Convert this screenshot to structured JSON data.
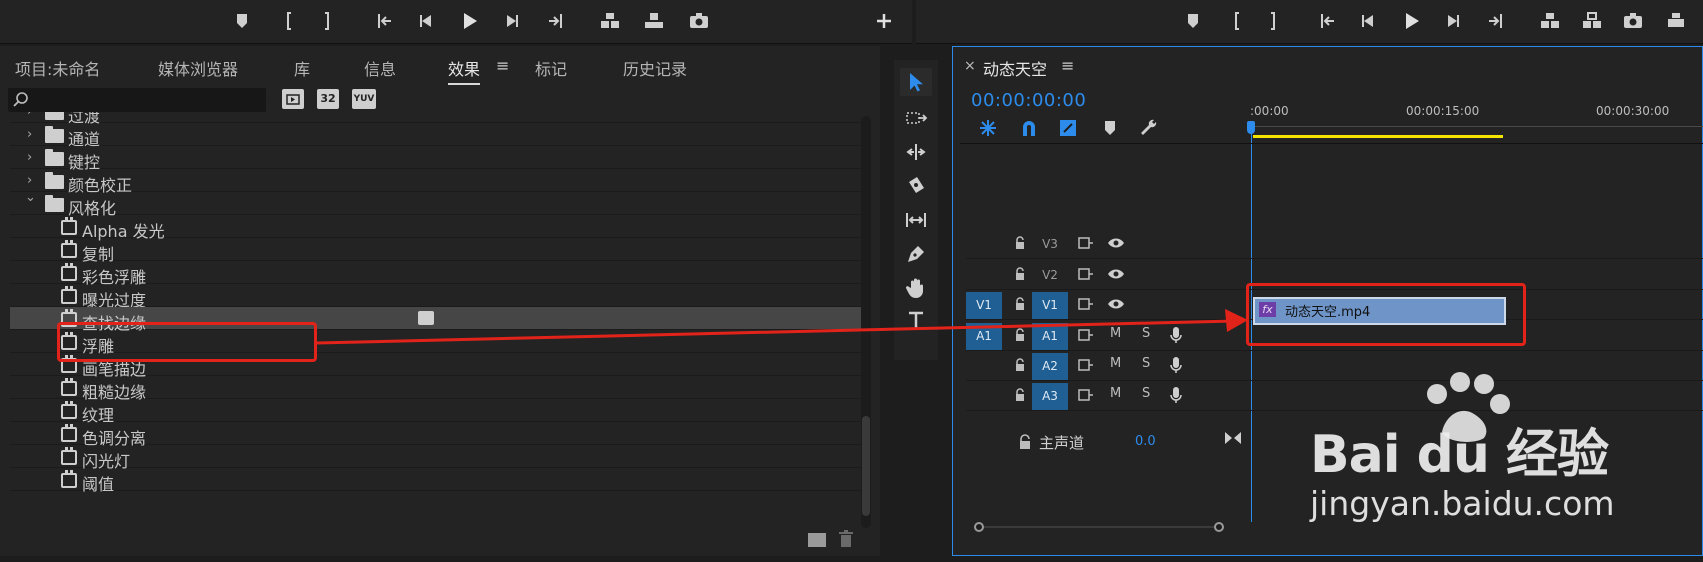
{
  "source_monitor": {
    "buttons": [
      "marker",
      "mark-in",
      "mark-out",
      "go-to-in",
      "step-back",
      "play",
      "step-forward",
      "go-to-out",
      "insert",
      "overwrite",
      "export-frame",
      "add"
    ]
  },
  "program_monitor": {
    "buttons": [
      "marker",
      "mark-in",
      "mark-out",
      "go-to-in",
      "step-back",
      "play",
      "step-forward",
      "go-to-out",
      "lift",
      "extract",
      "export-frame"
    ]
  },
  "project_panel": {
    "tabs": [
      "项目:未命名",
      "媒体浏览器",
      "库",
      "信息",
      "效果",
      "标记",
      "历史记录"
    ],
    "active_tab": "效果",
    "search_placeholder": "",
    "filter_labels": {
      "accel": "",
      "bit32": "32",
      "yuv": "YUV"
    },
    "items": [
      {
        "type": "folder",
        "label": "过渡",
        "expanded": false
      },
      {
        "type": "folder",
        "label": "通道",
        "expanded": false
      },
      {
        "type": "folder",
        "label": "键控",
        "expanded": false
      },
      {
        "type": "folder",
        "label": "颜色校正",
        "expanded": false
      },
      {
        "type": "folder",
        "label": "风格化",
        "expanded": true
      },
      {
        "type": "effect",
        "label": "Alpha 发光"
      },
      {
        "type": "effect",
        "label": "复制"
      },
      {
        "type": "effect",
        "label": "彩色浮雕"
      },
      {
        "type": "effect",
        "label": "曝光过度"
      },
      {
        "type": "effect",
        "label": "查找边缘",
        "selected": true
      },
      {
        "type": "effect",
        "label": "浮雕"
      },
      {
        "type": "effect",
        "label": "画笔描边"
      },
      {
        "type": "effect",
        "label": "粗糙边缘"
      },
      {
        "type": "effect",
        "label": "纹理"
      },
      {
        "type": "effect",
        "label": "色调分离"
      },
      {
        "type": "effect",
        "label": "闪光灯"
      },
      {
        "type": "effect",
        "label": "阈值"
      }
    ]
  },
  "timeline": {
    "close_label": "×",
    "sequence_name": "动态天空",
    "menu_label": "≡",
    "timecode": "00:00:00:00",
    "ruler": [
      ":00:00",
      "00:00:15:00",
      "00:00:30:00"
    ],
    "video_tracks": [
      {
        "patch": "",
        "name": "V3"
      },
      {
        "patch": "",
        "name": "V2"
      },
      {
        "patch": "V1",
        "name": "V1"
      }
    ],
    "audio_tracks": [
      {
        "patch": "A1",
        "name": "A1",
        "m": "M",
        "s": "S"
      },
      {
        "patch": "",
        "name": "A2",
        "m": "M",
        "s": "S"
      },
      {
        "patch": "",
        "name": "A3",
        "m": "M",
        "s": "S"
      }
    ],
    "master": {
      "label": "主声道",
      "value": "0.0"
    },
    "clip": {
      "fx": "fx",
      "name": "动态天空.mp4"
    }
  },
  "colors": {
    "accent": "#2d8ceb",
    "highlight": "#e2231a",
    "track_on": "#1f5f93",
    "clip": "#6f95c8",
    "workarea": "#f2e600"
  },
  "watermark": {
    "brand": "Bai du 经验",
    "url": "jingyan.baidu.com"
  }
}
